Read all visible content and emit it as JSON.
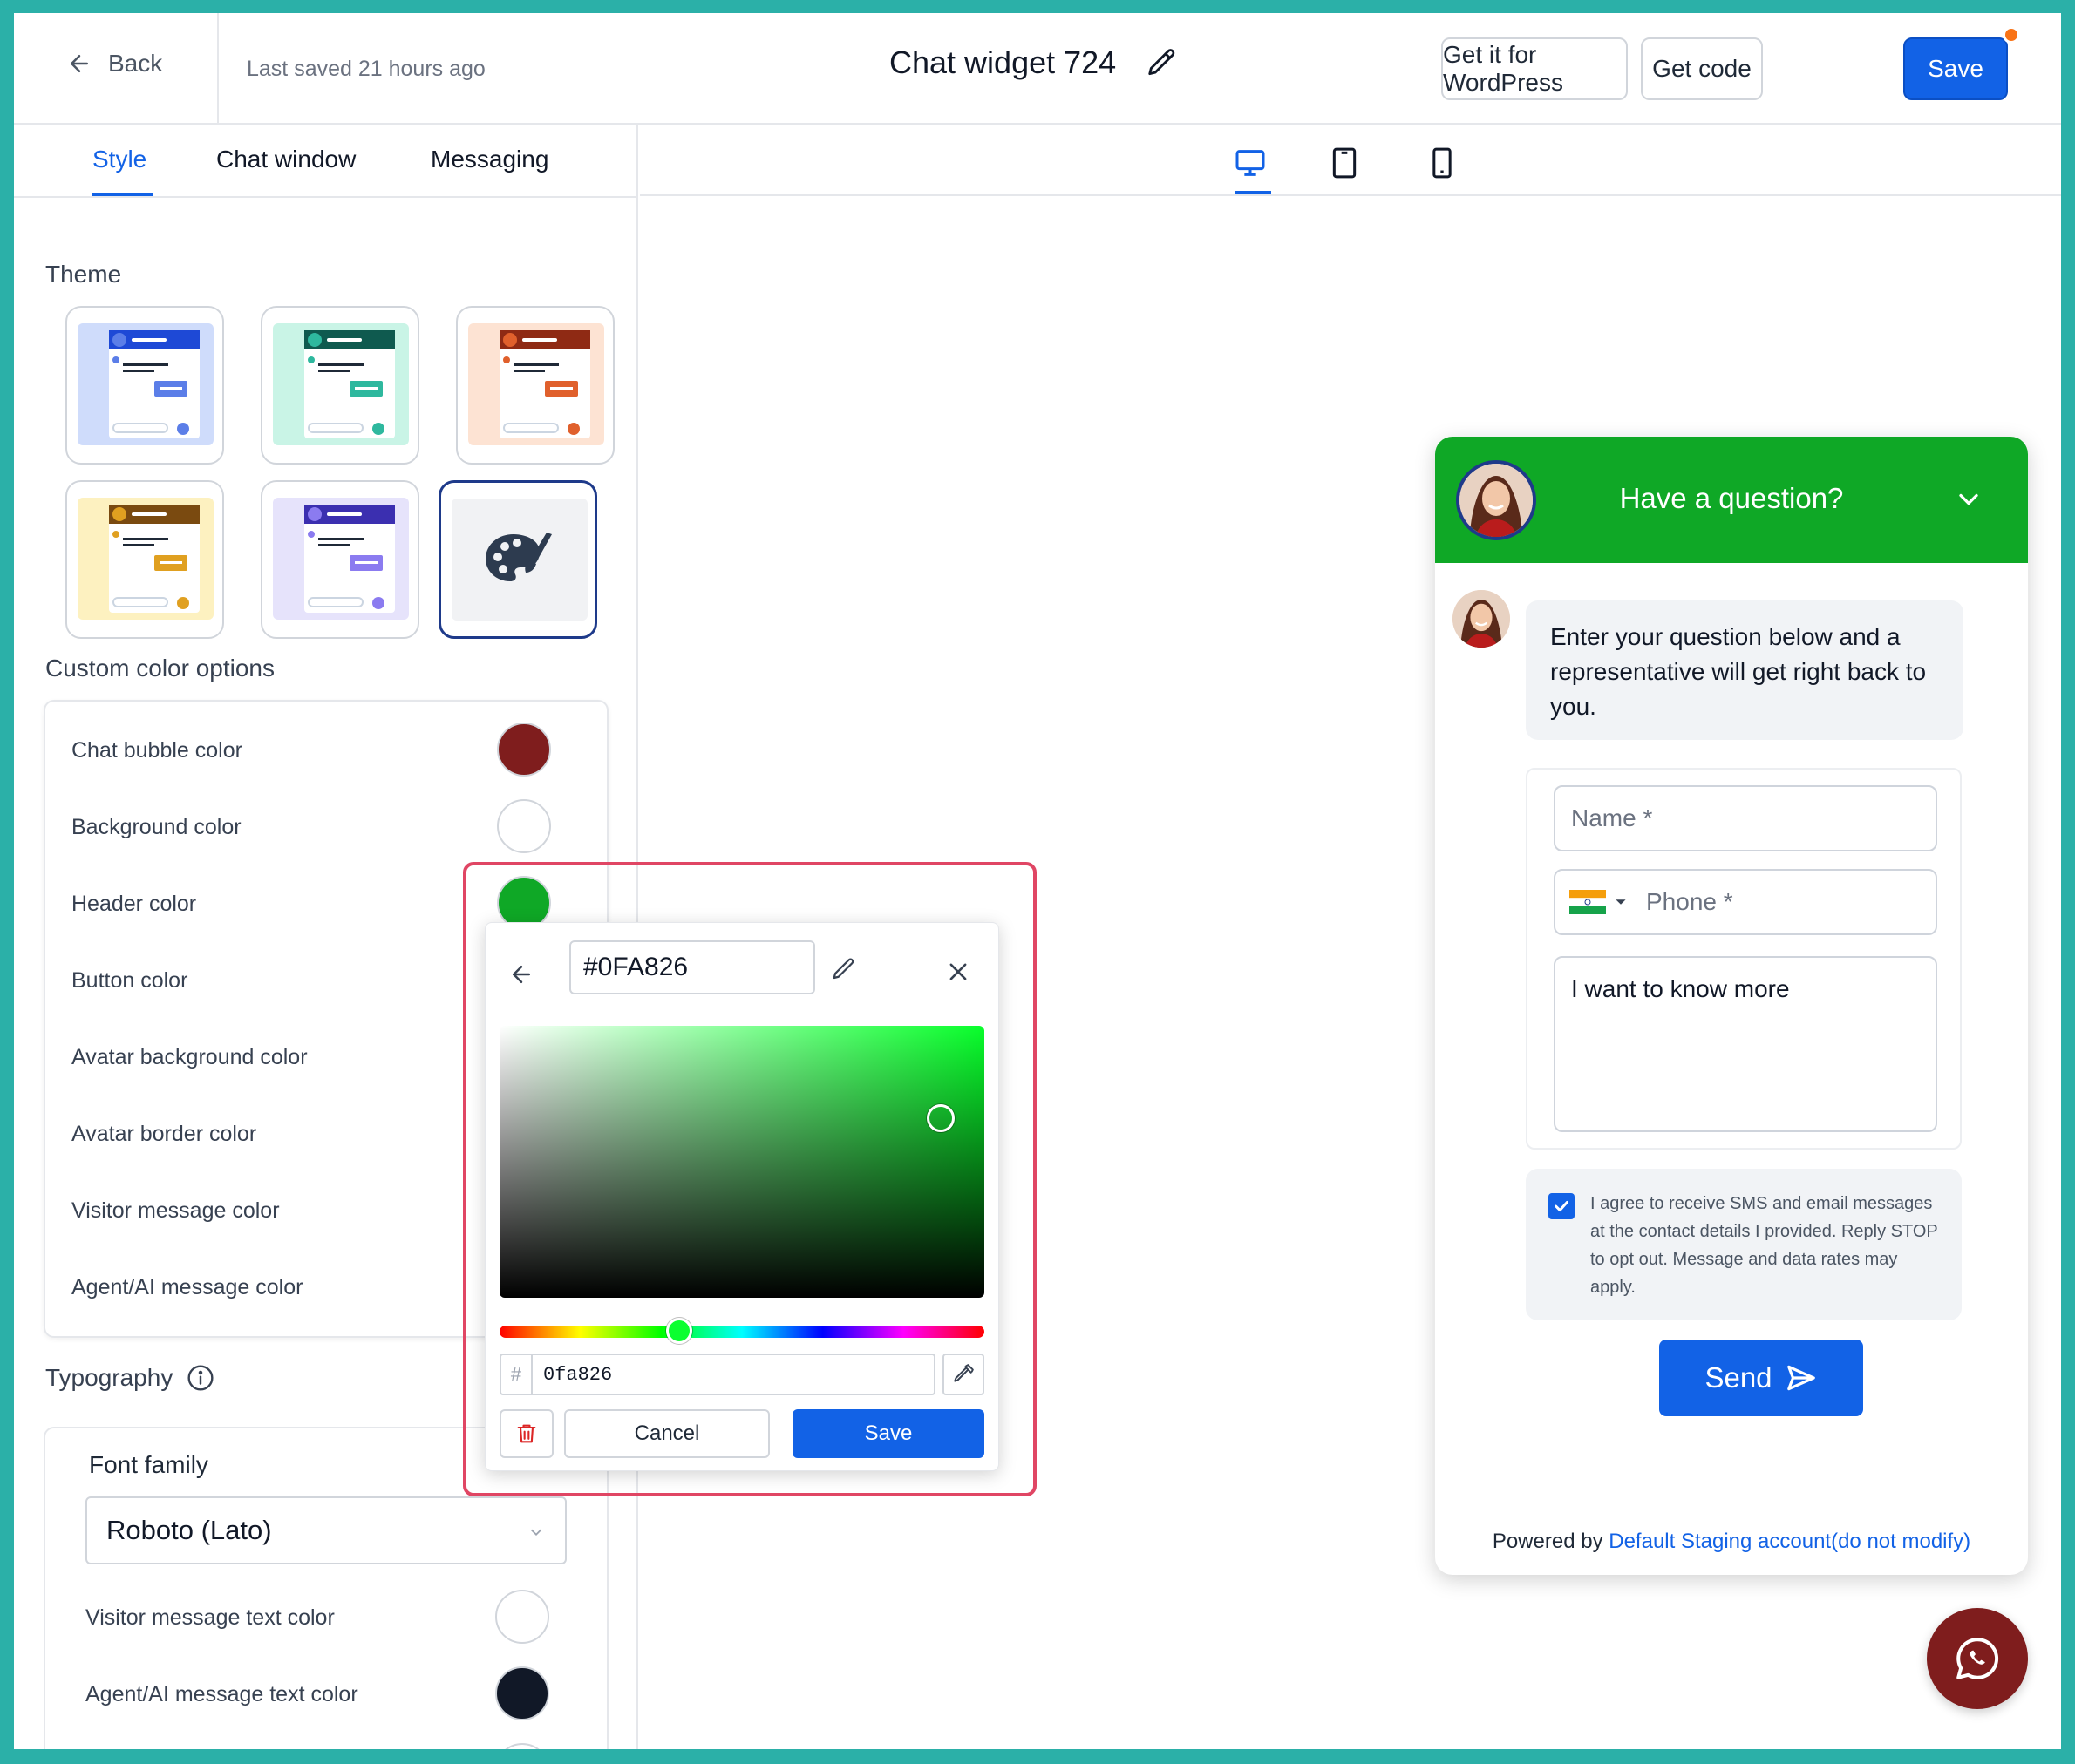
{
  "header": {
    "back_label": "Back",
    "last_saved": "Last saved 21 hours ago",
    "title": "Chat widget 724",
    "wordpress_label": "Get it for WordPress",
    "get_code_label": "Get code",
    "save_label": "Save"
  },
  "tabs": [
    {
      "label": "Style",
      "active": true
    },
    {
      "label": "Chat window",
      "active": false
    },
    {
      "label": "Messaging",
      "active": false
    }
  ],
  "theme": {
    "label": "Theme",
    "options": [
      {
        "bg": "#cfdcfb",
        "primary": "#1e49d6",
        "accent": "#5b7ee8"
      },
      {
        "bg": "#c9f4e6",
        "primary": "#0f5a4f",
        "accent": "#2eb89e"
      },
      {
        "bg": "#fde3d3",
        "primary": "#8f2a14",
        "accent": "#e0602c"
      },
      {
        "bg": "#fdf1c0",
        "primary": "#7a4a10",
        "accent": "#e0a020"
      },
      {
        "bg": "#e6e3fb",
        "primary": "#3b2fb0",
        "accent": "#8b7bf0"
      }
    ]
  },
  "custom_colors": {
    "label": "Custom color options",
    "rows": [
      {
        "label": "Chat bubble color",
        "color": "#7f1d1d"
      },
      {
        "label": "Background color",
        "color": "#ffffff"
      },
      {
        "label": "Header color",
        "color": "#0fa826"
      },
      {
        "label": "Button color"
      },
      {
        "label": "Avatar background color"
      },
      {
        "label": "Avatar border color"
      },
      {
        "label": "Visitor message color"
      },
      {
        "label": "Agent/AI message color"
      }
    ]
  },
  "typography": {
    "label": "Typography",
    "font_family_label": "Font family",
    "font_family_value": "Roboto (Lato)",
    "visitor_text_label": "Visitor message text color",
    "visitor_text_color": "#ffffff",
    "agent_text_label": "Agent/AI message text color",
    "agent_text_color": "#111827"
  },
  "color_picker": {
    "hex_display": "#0FA826",
    "hex_input": "0fa826",
    "hash": "#",
    "cancel_label": "Cancel",
    "save_label": "Save",
    "hue_fraction": 0.37,
    "saturation_fraction": 0.91,
    "brightness_fraction": 0.66
  },
  "widget": {
    "header_title": "Have a question?",
    "header_color": "#0fa826",
    "intro_message": "Enter your question below and a representative will get right back to you.",
    "name_placeholder": "Name *",
    "phone_placeholder": "Phone *",
    "message_value": "I want to know more",
    "consent_text": "I agree to receive SMS and email messages at the contact details I provided. Reply STOP to opt out. Message and data rates may apply.",
    "send_label": "Send",
    "powered_by": "Powered by",
    "account_link": "Default Staging account(do not modify)",
    "fab_color": "#7f1d1d"
  },
  "colors": {
    "accent": "#1262e6",
    "highlight": "#e04664",
    "background": "#2bb0a8"
  }
}
